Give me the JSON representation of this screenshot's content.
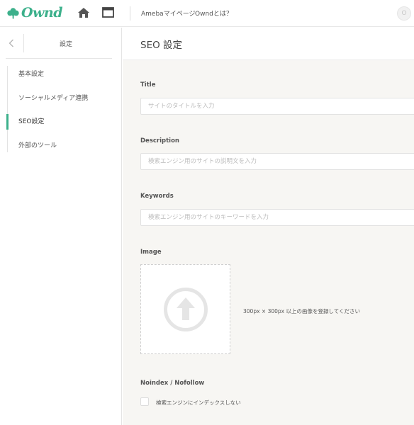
{
  "app": {
    "logo_text": "Ownd",
    "brand_color": "#3cb08b"
  },
  "topbar": {
    "links": [
      "Amebaマイページ",
      "Owndとは？"
    ],
    "avatar_initial": "O"
  },
  "sidebar": {
    "back_icon": "chevron-left-icon",
    "title": "設定",
    "items": [
      {
        "label": "基本設定",
        "active": false
      },
      {
        "label": "ソーシャルメディア連携",
        "active": false
      },
      {
        "label": "SEO設定",
        "active": true
      },
      {
        "label": "外部のツール",
        "active": false
      }
    ]
  },
  "main": {
    "page_title": "SEO 設定",
    "fields": {
      "title": {
        "label": "Title",
        "value": "",
        "placeholder": "サイトのタイトルを入力"
      },
      "description": {
        "label": "Description",
        "value": "",
        "placeholder": "検索エンジン用のサイトの説明文を入力"
      },
      "keywords": {
        "label": "Keywords",
        "value": "",
        "placeholder": "検索エンジン用のサイトのキーワードを入力"
      }
    },
    "image": {
      "label": "Image",
      "upload_icon": "upload-arrow-icon",
      "hint": "300px × 300px 以上の画像を登録してください"
    },
    "noindex": {
      "label": "Noindex / Nofollow",
      "checkbox_label": "検索エンジンにインデックスしない",
      "checked": false
    }
  }
}
